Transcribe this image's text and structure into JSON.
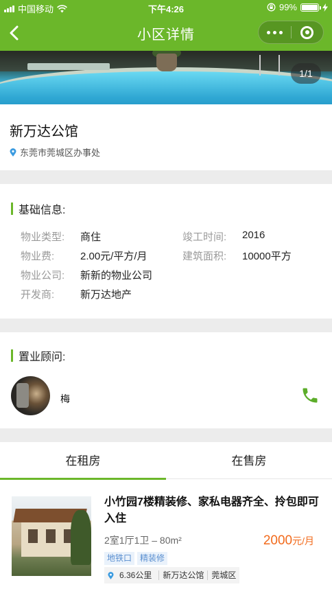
{
  "status_bar": {
    "carrier": "中国移动",
    "time": "下午4:26",
    "battery": "99%"
  },
  "nav": {
    "title": "小区详情"
  },
  "banner": {
    "counter": "1/1"
  },
  "community": {
    "name": "新万达公馆",
    "address": "东莞市莞城区办事处"
  },
  "basic_info": {
    "title": "基础信息:",
    "property_type_label": "物业类型:",
    "property_type_value": "商住",
    "completion_label": "竣工时间:",
    "completion_value": "2016",
    "fee_label": "物业费:",
    "fee_value": "2.00元/平方/月",
    "area_label": "建筑面积:",
    "area_value": "10000平方",
    "company_label": "物业公司:",
    "company_value": "新新的物业公司",
    "developer_label": "开发商:",
    "developer_value": "新万达地产"
  },
  "agent": {
    "title": "置业顾问:",
    "name": "梅"
  },
  "tabs": {
    "rent": "在租房",
    "sale": "在售房"
  },
  "listing": {
    "title": "小竹园7楼精装修、家私电器齐全、拎包即可入住",
    "spec": "2室1厅1卫 – 80m²",
    "price": "2000",
    "price_unit": "元/月",
    "tags": [
      "地铁口",
      "精装修"
    ],
    "distance": "6.36公里",
    "community": "新万达公馆",
    "district": "莞城区"
  },
  "colors": {
    "brand_green": "#6bb72a",
    "price_orange": "#f26a1b",
    "tag_blue": "#5a8fd0"
  }
}
